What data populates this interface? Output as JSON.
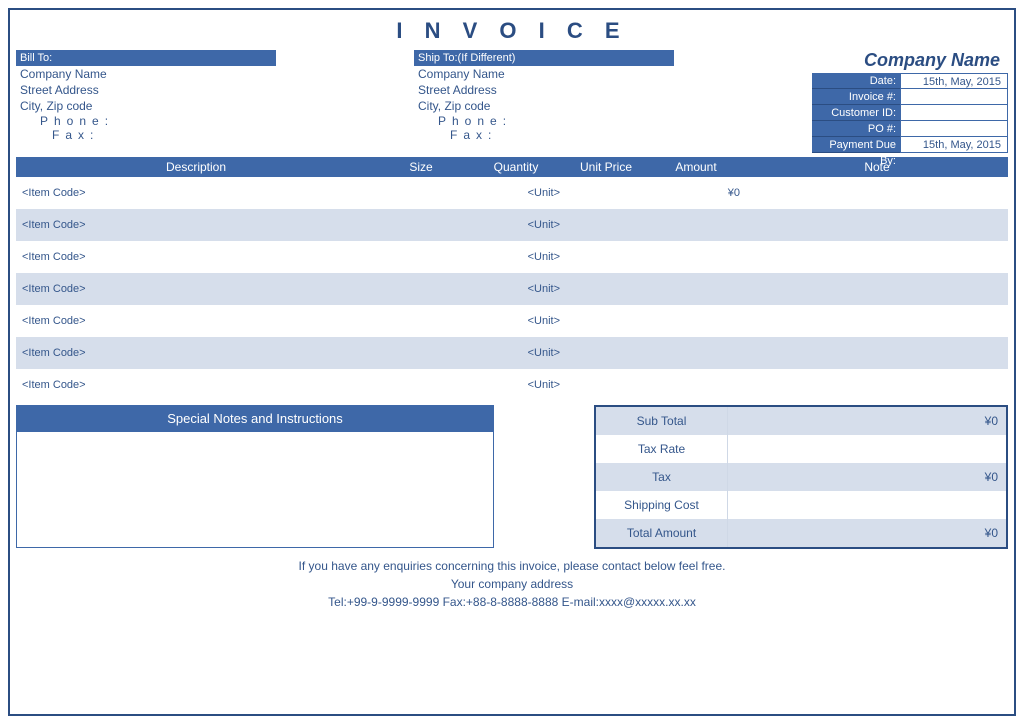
{
  "title": "I N V O I C E",
  "bill_to": {
    "header": "Bill To:",
    "company": "Company Name",
    "street": "Street Address",
    "city": "City, Zip code",
    "phone_label": "Phone:",
    "fax_label": "Fax:"
  },
  "ship_to": {
    "header": "Ship To:(If Different)",
    "company": "Company Name",
    "street": "Street Address",
    "city": "City, Zip code",
    "phone_label": "Phone:",
    "fax_label": "Fax:"
  },
  "company_name": "Company Name",
  "meta_rows": [
    {
      "label": "Date:",
      "value": "15th, May, 2015"
    },
    {
      "label": "Invoice #:",
      "value": ""
    },
    {
      "label": "Customer ID:",
      "value": ""
    },
    {
      "label": "PO #:",
      "value": ""
    },
    {
      "label": "Payment Due By:",
      "value": "15th, May, 2015"
    }
  ],
  "columns": {
    "desc": "Description",
    "size": "Size",
    "qty": "Quantity",
    "unitp": "Unit Price",
    "amount": "Amount",
    "note": "Note"
  },
  "rows": [
    {
      "code": "<Item Code>",
      "unit": "<Unit>",
      "amount": "¥0"
    },
    {
      "code": "<Item Code>",
      "unit": "<Unit>",
      "amount": ""
    },
    {
      "code": "<Item Code>",
      "unit": "<Unit>",
      "amount": ""
    },
    {
      "code": "<Item Code>",
      "unit": "<Unit>",
      "amount": ""
    },
    {
      "code": "<Item Code>",
      "unit": "<Unit>",
      "amount": ""
    },
    {
      "code": "<Item Code>",
      "unit": "<Unit>",
      "amount": ""
    },
    {
      "code": "<Item Code>",
      "unit": "<Unit>",
      "amount": ""
    }
  ],
  "notes_header": "Special Notes and Instructions",
  "totals": [
    {
      "label": "Sub Total",
      "value": "¥0",
      "shaded": true
    },
    {
      "label": "Tax Rate",
      "value": "",
      "shaded": false
    },
    {
      "label": "Tax",
      "value": "¥0",
      "shaded": true
    },
    {
      "label": "Shipping Cost",
      "value": "",
      "shaded": false
    },
    {
      "label": "Total Amount",
      "value": "¥0",
      "shaded": true
    }
  ],
  "footer": {
    "line1": "If you have any enquiries concerning this invoice, please contact below feel free.",
    "line2": "Your company address",
    "line3": "Tel:+99-9-9999-9999 Fax:+88-8-8888-8888 E-mail:xxxx@xxxxx.xx.xx"
  }
}
